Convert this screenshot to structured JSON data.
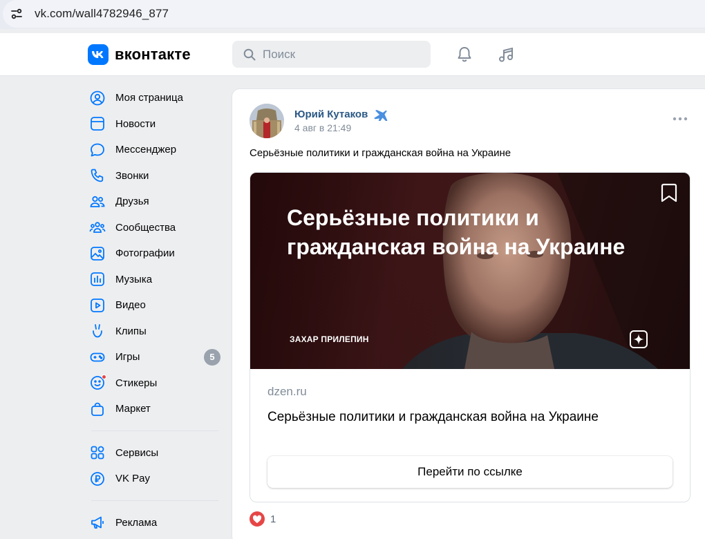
{
  "browser": {
    "url": "vk.com/wall4782946_877"
  },
  "header": {
    "logo_mark": "vk",
    "logo_text": "вконтакте",
    "search_placeholder": "Поиск",
    "icons": [
      "bell-icon",
      "music-note-icon"
    ]
  },
  "sidebar": {
    "items": [
      {
        "label": "Моя страница",
        "icon": "user-circle-icon"
      },
      {
        "label": "Новости",
        "icon": "news-icon"
      },
      {
        "label": "Мессенджер",
        "icon": "chat-bubble-icon"
      },
      {
        "label": "Звонки",
        "icon": "phone-icon"
      },
      {
        "label": "Друзья",
        "icon": "friends-icon"
      },
      {
        "label": "Сообщества",
        "icon": "communities-icon"
      },
      {
        "label": "Фотографии",
        "icon": "photo-icon"
      },
      {
        "label": "Музыка",
        "icon": "music-bars-icon"
      },
      {
        "label": "Видео",
        "icon": "video-icon"
      },
      {
        "label": "Клипы",
        "icon": "clips-icon"
      },
      {
        "label": "Игры",
        "icon": "gamepad-icon",
        "badge": "5"
      },
      {
        "label": "Стикеры",
        "icon": "smiley-icon"
      },
      {
        "label": "Маркет",
        "icon": "shopping-bag-icon"
      }
    ],
    "items2": [
      {
        "label": "Сервисы",
        "icon": "grid-icon"
      },
      {
        "label": "VK Pay",
        "icon": "ruble-icon"
      }
    ],
    "items3": [
      {
        "label": "Реклама",
        "icon": "megaphone-icon"
      }
    ]
  },
  "post": {
    "author": "Юрий Кутаков",
    "date": "4 авг в 21:49",
    "text": "Серьёзные политики и гражданская война на Украине",
    "attachment": {
      "image_title": "Серьёзные политики и гражданская война на Украине",
      "image_author": "ЗАХАР ПРИЛЕПИН",
      "domain": "dzen.ru",
      "title": "Серьёзные политики и гражданская война на Украине",
      "button_label": "Перейти по ссылке"
    },
    "likes": "1"
  },
  "colors": {
    "accent": "#0077ff",
    "link": "#2a5885",
    "like": "#e64646",
    "badge": "#99a2ad"
  }
}
